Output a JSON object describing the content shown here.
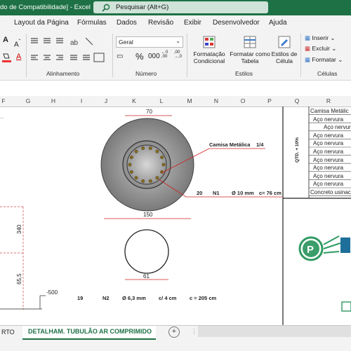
{
  "titlebar": {
    "doc_title": "do de Compatibilidade]  -  Excel",
    "search_placeholder": "Pesquisar (Alt+G)"
  },
  "tabs": [
    "Layout da Página",
    "Fórmulas",
    "Dados",
    "Revisão",
    "Exibir",
    "Desenvolvedor",
    "Ajuda"
  ],
  "ribbon": {
    "alignment_label": "Alinhamento",
    "number_label": "Número",
    "number_format": "Geral",
    "styles_label": "Estilos",
    "cells_label": "Células",
    "cond_format_line1": "Formatação",
    "cond_format_line2": "Condicional",
    "table_format_line1": "Formatar como",
    "table_format_line2": "Tabela",
    "cell_styles_line1": "Estilos de",
    "cell_styles_line2": "Célula",
    "insert": "Inserir",
    "delete": "Excluir",
    "format": "Formatar"
  },
  "columns": [
    "F",
    "G",
    "H",
    "I",
    "J",
    "K",
    "L",
    "M",
    "N",
    "O",
    "P",
    "Q",
    "R"
  ],
  "drawing": {
    "dim_top": "70",
    "label_sleeve": "Camisa Metálica",
    "sleeve_fraction": "1/4",
    "n1_qty": "20",
    "n1_id": "N1",
    "n1_diam": "Ø 10 mm",
    "n1_length": "c= 76 cm",
    "dim_150": "150",
    "dim_61": "61",
    "dim_340": "340",
    "dim_655": "65,5",
    "level": "-500",
    "n2_qty": "19",
    "n2_id": "N2",
    "n2_diam": "Ø 6,3 mm",
    "n2_spacing": "c/ 4 cm",
    "n2_length": "c = 205 cm"
  },
  "side_table": {
    "qty_header": "QTD. + 10%",
    "rows": [
      "Camisa Metálic",
      "Aço nervura",
      "Aço nervur",
      "Aço nervura",
      "Aço nervura",
      "Aço nervura",
      "Aço nervura",
      "Aço nervura",
      "Aço nervura",
      "Aço nervura",
      "Concreto usinac"
    ]
  },
  "sheet_tabs": {
    "prev_tab": "RTO",
    "active_tab": "DETALHAM. TUBULÃO AR COMPRIMIDO",
    "add_icon": "plus-icon"
  },
  "colors": {
    "excel_green": "#1e7145",
    "rebar_red": "#cc2222"
  }
}
